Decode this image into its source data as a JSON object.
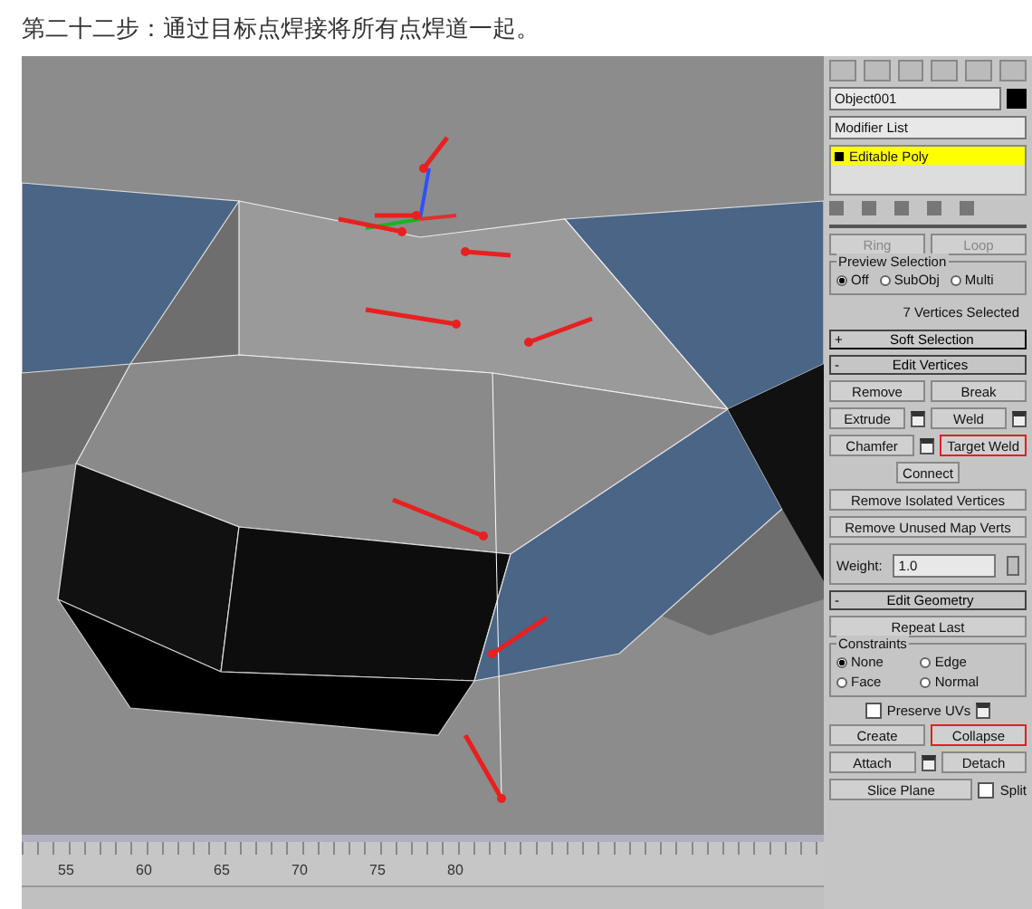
{
  "caption": "第二十二步：通过目标点焊接将所有点焊道一起。",
  "panel": {
    "object_name": "Object001",
    "modifier_list": "Modifier List",
    "stack": [
      {
        "label": "Editable Poly",
        "selected": true
      }
    ],
    "partial_buttons": [
      "Ring",
      "Loop"
    ],
    "preview_selection": {
      "title": "Preview Selection",
      "options": [
        {
          "label": "Off",
          "selected": true
        },
        {
          "label": "SubObj",
          "selected": false
        },
        {
          "label": "Multi",
          "selected": false
        }
      ]
    },
    "selection_info": "7 Vertices Selected",
    "rollouts": [
      {
        "sign": "+",
        "title": "Soft Selection",
        "expanded": false
      },
      {
        "sign": "-",
        "title": "Edit Vertices",
        "expanded": true,
        "rows": [
          [
            {
              "kind": "button",
              "label": "Remove",
              "highlighted": false
            },
            {
              "kind": "button",
              "label": "Break",
              "highlighted": false
            }
          ],
          [
            {
              "kind": "button",
              "label": "Extrude",
              "highlighted": false
            },
            {
              "kind": "settings"
            },
            {
              "kind": "button",
              "label": "Weld",
              "highlighted": false
            },
            {
              "kind": "settings"
            }
          ],
          [
            {
              "kind": "button",
              "label": "Chamfer",
              "highlighted": false
            },
            {
              "kind": "settings"
            },
            {
              "kind": "button",
              "label": "Target Weld",
              "highlighted": true
            }
          ],
          [
            {
              "kind": "button",
              "label": "Connect",
              "highlighted": false
            }
          ],
          [
            {
              "kind": "button",
              "label": "Remove Isolated Vertices",
              "highlighted": false
            }
          ],
          [
            {
              "kind": "button",
              "label": "Remove Unused Map Verts",
              "highlighted": false
            }
          ]
        ]
      }
    ],
    "weight": {
      "label": "Weight:",
      "value": "1.0"
    },
    "edit_geometry": {
      "sign": "-",
      "title": "Edit Geometry",
      "expanded": true,
      "repeat": "Repeat Last",
      "constraints_title": "Constraints",
      "constraints": [
        {
          "label": "None",
          "selected": true
        },
        {
          "label": "Edge",
          "selected": false
        },
        {
          "label": "Face",
          "selected": false
        },
        {
          "label": "Normal",
          "selected": false
        }
      ],
      "preserve_uvs": {
        "label": "Preserve UVs",
        "checked": false
      },
      "rows": [
        [
          {
            "kind": "button",
            "label": "Create",
            "highlighted": false
          },
          {
            "kind": "button",
            "label": "Collapse",
            "highlighted": true
          }
        ],
        [
          {
            "kind": "button",
            "label": "Attach",
            "highlighted": false
          },
          {
            "kind": "settings"
          },
          {
            "kind": "button",
            "label": "Detach",
            "highlighted": false
          }
        ]
      ],
      "slice_plane": "Slice Plane",
      "split": {
        "label": "Split",
        "checked": false
      }
    }
  },
  "timeline": {
    "ticks": [
      "55",
      "60",
      "65",
      "70",
      "75",
      "80"
    ]
  }
}
